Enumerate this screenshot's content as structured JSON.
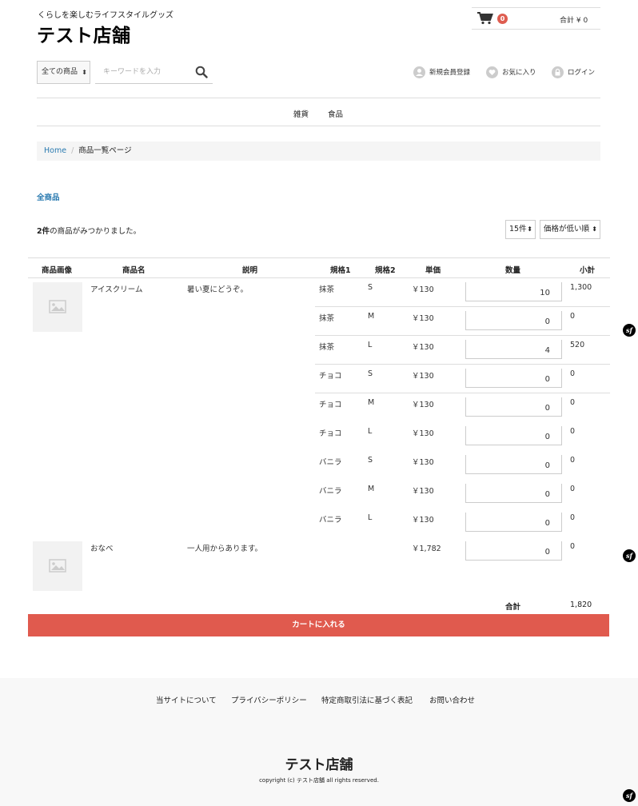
{
  "header": {
    "tagline": "くらしを楽しむライフスタイルグッズ",
    "store_name": "テスト店舗",
    "cart": {
      "count": "0",
      "total_label": "合計 ¥ 0"
    }
  },
  "search": {
    "category": "全ての商品",
    "placeholder": "キーワードを入力"
  },
  "user_links": [
    {
      "label": "新規会員登録",
      "icon": "user-icon"
    },
    {
      "label": "お気に入り",
      "icon": "heart-icon"
    },
    {
      "label": "ログイン",
      "icon": "lock-icon"
    }
  ],
  "nav": [
    "雑貨",
    "食品"
  ],
  "breadcrumb": {
    "home": "Home",
    "current": "商品一覧ページ"
  },
  "category_heading": "全商品",
  "results": {
    "count": "2件",
    "suffix": "の商品がみつかりました。"
  },
  "per_page": "15件",
  "sort": "価格が低い順",
  "table": {
    "headers": [
      "商品画像",
      "商品名",
      "説明",
      "規格1",
      "規格2",
      "単価",
      "数量",
      "小計"
    ],
    "products": [
      {
        "name": "アイスクリーム",
        "description": "暑い夏にどうぞ。",
        "variants": [
          {
            "class1": "抹茶",
            "class2": "S",
            "price": "￥130",
            "qty": "10",
            "subtotal": "1,300"
          },
          {
            "class1": "抹茶",
            "class2": "M",
            "price": "￥130",
            "qty": "0",
            "subtotal": "0"
          },
          {
            "class1": "抹茶",
            "class2": "L",
            "price": "￥130",
            "qty": "4",
            "subtotal": "520"
          },
          {
            "class1": "チョコ",
            "class2": "S",
            "price": "￥130",
            "qty": "0",
            "subtotal": "0"
          },
          {
            "class1": "チョコ",
            "class2": "M",
            "price": "￥130",
            "qty": "0",
            "subtotal": "0"
          },
          {
            "class1": "チョコ",
            "class2": "L",
            "price": "￥130",
            "qty": "0",
            "subtotal": "0"
          },
          {
            "class1": "バニラ",
            "class2": "S",
            "price": "￥130",
            "qty": "0",
            "subtotal": "0"
          },
          {
            "class1": "バニラ",
            "class2": "M",
            "price": "￥130",
            "qty": "0",
            "subtotal": "0"
          },
          {
            "class1": "バニラ",
            "class2": "L",
            "price": "￥130",
            "qty": "0",
            "subtotal": "0"
          }
        ]
      },
      {
        "name": "おなべ",
        "description": "一人用からあります。",
        "variants": [
          {
            "class1": "",
            "class2": "",
            "price": "￥1,782",
            "qty": "0",
            "subtotal": "0"
          }
        ]
      }
    ]
  },
  "summary": {
    "label": "合計",
    "value": "1,820"
  },
  "cart_button": "カートに入れる",
  "footer": {
    "links": [
      "当サイトについて",
      "プライバシーポリシー",
      "特定商取引法に基づく表記",
      "お問い合わせ"
    ],
    "store_name": "テスト店舗",
    "copyright": "copyright (c) テスト店舗 all rights reserved."
  },
  "sf_badge": "sf",
  "colors": {
    "accent": "#e05a4e",
    "link": "#2a7ab0"
  }
}
